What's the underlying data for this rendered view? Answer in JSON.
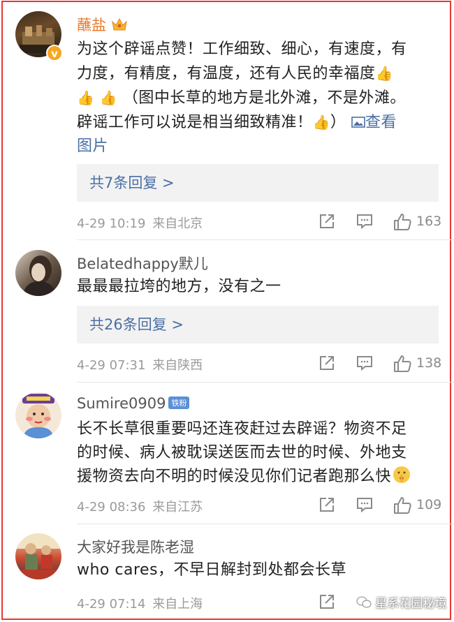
{
  "comments": [
    {
      "username": "蘸盐",
      "verified_badge": "v",
      "text_line1": "为这个辟谣点赞！工作细致、细心，有速度，有",
      "text_line2": "力度，有精度，有温度，还有人民的幸福度",
      "text_line3": "（图中长草的地方是北外滩，不是外滩。",
      "text_line4": "辟谣工作可以说是相当细致精准！",
      "text_line4_end": "）",
      "view_image_label": "查看",
      "view_image_label2": "图片",
      "replies": "共7条回复 >",
      "timestamp": "4-29 10:19",
      "source": "来自北京",
      "likes": "163"
    },
    {
      "username": "Belatedhappy默儿",
      "text_line1": "最最最拉垮的地方，没有之一",
      "replies": "共26条回复 >",
      "timestamp": "4-29 07:31",
      "source": "来自陕西",
      "likes": "138"
    },
    {
      "username": "Sumire0909",
      "fan_badge": "铁粉",
      "text_line1": "长不长草很重要吗还连夜赶过去辟谣？物资不足",
      "text_line2": "的时候、病人被耽误送医而去世的时候、外地支",
      "text_line3": "援物资去向不明的时候没见你们记者跑那么快",
      "timestamp": "4-29 08:36",
      "source": "来自江苏",
      "likes": "109"
    },
    {
      "username": "大家好我是陈老湿",
      "text_line1": "who cares，不早日解封到处都会长草",
      "timestamp": "4-29 07:14",
      "source": "来自上海"
    }
  ],
  "watermark": "星系花园秘境",
  "colors": {
    "link": "#4a6fa5",
    "vip_name": "#e8782a",
    "frame": "#e53935"
  },
  "icons": [
    "share-icon",
    "comment-icon",
    "like-icon",
    "crown-icon",
    "thumbs-up-emoji",
    "image-icon",
    "shush-emoji"
  ]
}
